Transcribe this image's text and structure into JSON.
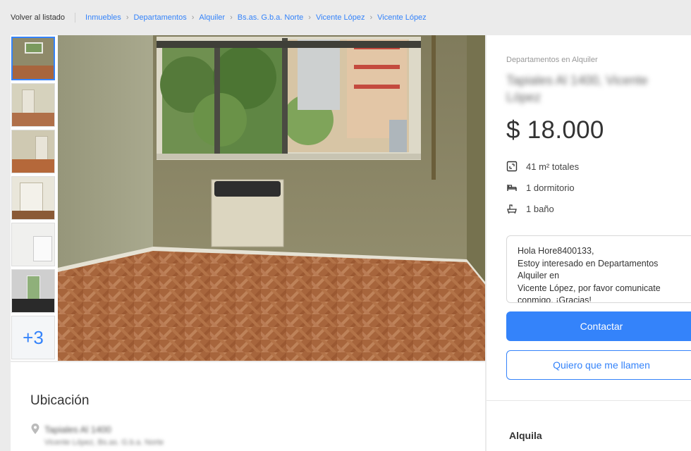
{
  "breadcrumb": {
    "back_label": "Volver al listado",
    "items": [
      "Inmuebles",
      "Departamentos",
      "Alquiler",
      "Bs.as. G.b.a. Norte",
      "Vicente López",
      "Vicente López"
    ]
  },
  "gallery": {
    "more_label": "+3"
  },
  "listing": {
    "category": "Departamentos en Alquiler",
    "address_title": "Tapiales Al 1400, Vicente López",
    "price": "$ 18.000",
    "features": [
      {
        "icon": "area-icon",
        "label": "41 m² totales"
      },
      {
        "icon": "bed-icon",
        "label": "1 dormitorio"
      },
      {
        "icon": "bathroom-icon",
        "label": "1 baño"
      }
    ],
    "message": "Hola Hore8400133,\nEstoy interesado en Departamentos Alquiler en\nVicente López, por favor comunicate\nconmigo. ¡Gracias!",
    "contact_label": "Contactar",
    "callback_label": "Quiero que me llamen",
    "section_rent": "Alquila"
  },
  "location": {
    "title": "Ubicación",
    "street": "Tapiales Al 1400",
    "city": "Vicente López, Bs.as. G.b.a. Norte"
  },
  "colors": {
    "accent": "#3483fa",
    "background": "#ebebeb"
  }
}
